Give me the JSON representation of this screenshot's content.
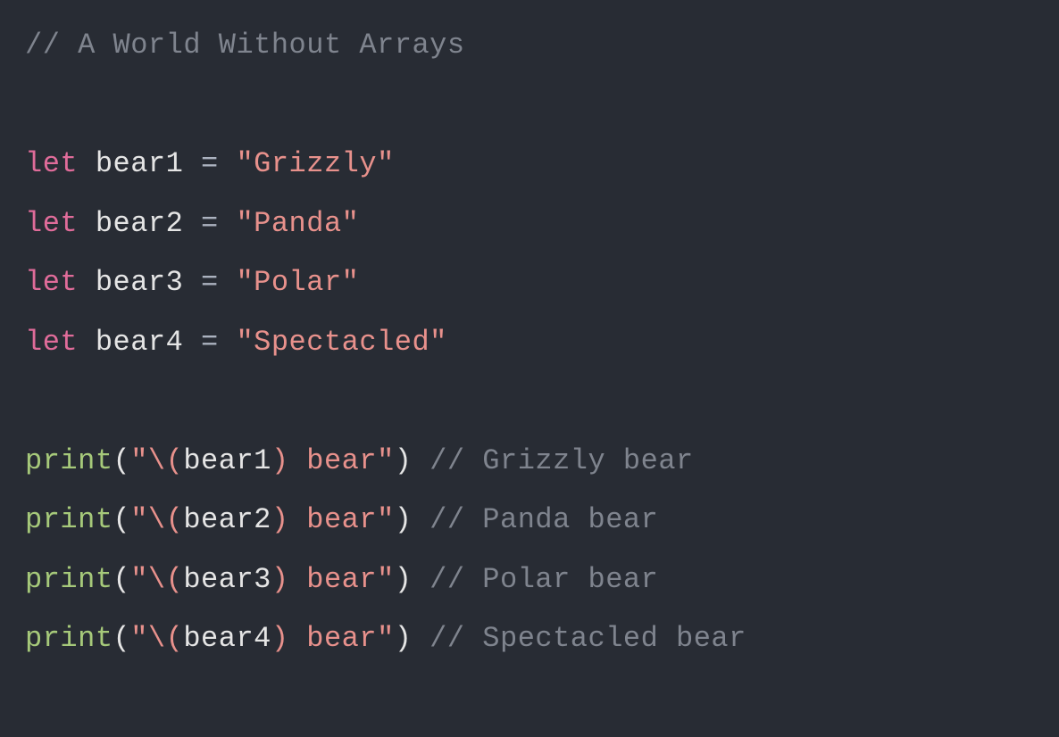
{
  "code": {
    "lines": [
      {
        "type": "comment",
        "text": "// A World Without Arrays"
      },
      {
        "type": "blank"
      },
      {
        "type": "let",
        "name": "bear1",
        "value": "\"Grizzly\""
      },
      {
        "type": "let",
        "name": "bear2",
        "value": "\"Panda\""
      },
      {
        "type": "let",
        "name": "bear3",
        "value": "\"Polar\""
      },
      {
        "type": "let",
        "name": "bear4",
        "value": "\"Spectacled\""
      },
      {
        "type": "blank"
      },
      {
        "type": "print",
        "func": "print",
        "string_open": "\"\\(",
        "var": "bear1",
        "string_close": ") bear\"",
        "comment": "// Grizzly bear"
      },
      {
        "type": "print",
        "func": "print",
        "string_open": "\"\\(",
        "var": "bear2",
        "string_close": ") bear\"",
        "comment": "// Panda bear"
      },
      {
        "type": "print",
        "func": "print",
        "string_open": "\"\\(",
        "var": "bear3",
        "string_close": ") bear\"",
        "comment": "// Polar bear"
      },
      {
        "type": "print",
        "func": "print",
        "string_open": "\"\\(",
        "var": "bear4",
        "string_close": ") bear\"",
        "comment": "// Spectacled bear"
      }
    ],
    "keyword_let": "let",
    "op_eq": "="
  }
}
